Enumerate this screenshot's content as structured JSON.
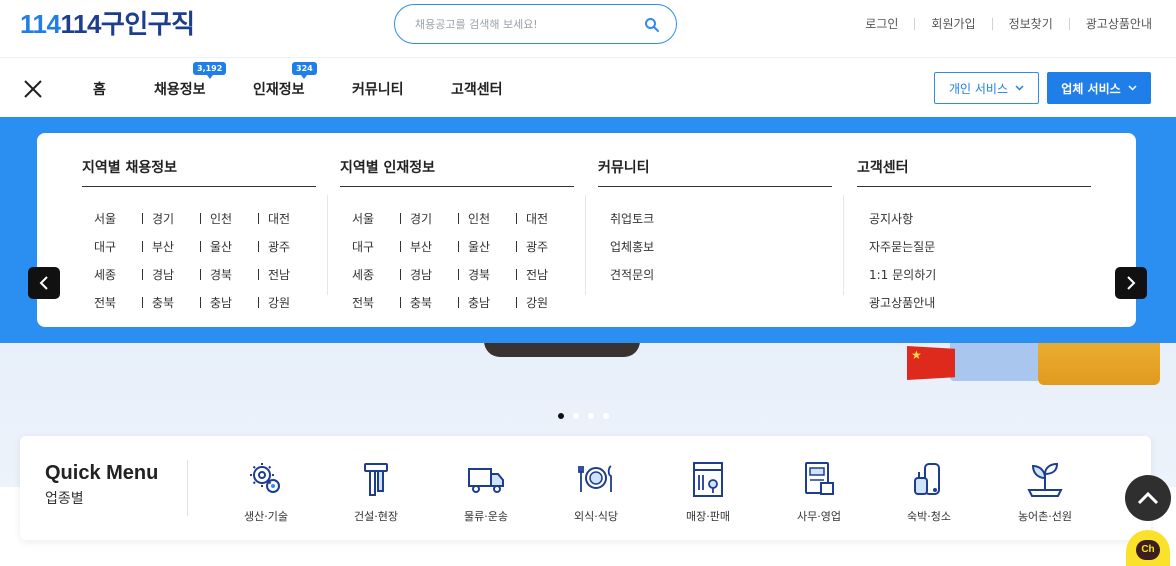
{
  "header": {
    "logo_part1": "114",
    "logo_part2": "114구인구직",
    "search_placeholder": "채용공고를 검색해 보세요!",
    "links": [
      "로그인",
      "회원가입",
      "정보찾기",
      "광고상품안내"
    ]
  },
  "nav": {
    "items": [
      {
        "label": "홈",
        "badge": ""
      },
      {
        "label": "채용정보",
        "badge": "3,192"
      },
      {
        "label": "인재정보",
        "badge": "324"
      },
      {
        "label": "커뮤니티",
        "badge": ""
      },
      {
        "label": "고객센터",
        "badge": ""
      }
    ],
    "personal_service": "개인 서비스",
    "business_service": "업체 서비스"
  },
  "mega_menu": {
    "job_by_region": {
      "title": "지역별 채용정보",
      "rows": [
        [
          "서울",
          "경기",
          "인천",
          "대전"
        ],
        [
          "대구",
          "부산",
          "울산",
          "광주"
        ],
        [
          "세종",
          "경남",
          "경북",
          "전남"
        ],
        [
          "전북",
          "충북",
          "충남",
          "강원"
        ]
      ]
    },
    "talent_by_region": {
      "title": "지역별 인재정보",
      "rows": [
        [
          "서울",
          "경기",
          "인천",
          "대전"
        ],
        [
          "대구",
          "부산",
          "울산",
          "광주"
        ],
        [
          "세종",
          "경남",
          "경북",
          "전남"
        ],
        [
          "전북",
          "충북",
          "충남",
          "강원"
        ]
      ]
    },
    "community": {
      "title": "커뮤니티",
      "items": [
        "취업토크",
        "업체홍보",
        "견적문의"
      ]
    },
    "support": {
      "title": "고객센터",
      "items": [
        "공지사항",
        "자주묻는질문",
        "1:1 문의하기",
        "광고상품안내"
      ]
    }
  },
  "quick_menu": {
    "title": "Quick Menu",
    "subtitle": "업종별",
    "items": [
      {
        "label": "생산·기술",
        "icon": "gears-icon"
      },
      {
        "label": "건설·현장",
        "icon": "hammer-icon"
      },
      {
        "label": "물류·운송",
        "icon": "truck-icon"
      },
      {
        "label": "외식·식당",
        "icon": "dining-icon"
      },
      {
        "label": "매장·판매",
        "icon": "store-icon"
      },
      {
        "label": "사무·영업",
        "icon": "office-icon"
      },
      {
        "label": "숙박·청소",
        "icon": "vacuum-icon"
      },
      {
        "label": "농어촌·선원",
        "icon": "plant-icon"
      }
    ]
  },
  "carousel": {
    "slides": 4,
    "active": 1
  },
  "chat": {
    "label": "Ch"
  },
  "colors": {
    "brand_blue": "#1f7ee8",
    "brand_navy": "#1d3d8f",
    "menu_blue": "#2b8ff1"
  }
}
